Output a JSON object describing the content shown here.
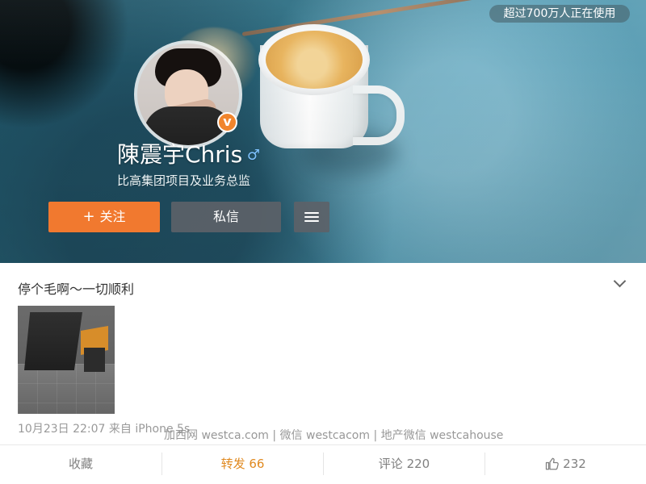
{
  "header": {
    "usage_badge": "超过700万人正在使用"
  },
  "profile": {
    "name": "陳震宇Chris",
    "gender_icon": "♂",
    "title": "比高集团项目及业务总监",
    "verified_icon": "v",
    "actions": {
      "follow_icon": "+",
      "follow_label": "关注",
      "message_label": "私信"
    }
  },
  "post": {
    "text": "停个毛啊～一切顺利",
    "meta": "10月23日 22:07 来自 iPhone 5s"
  },
  "watermark": {
    "text": "加西网 westca.com | 微信 westcacom | 地产微信 westcahouse"
  },
  "bottom_bar": {
    "save_label": "收藏",
    "repost_label": "转发 66",
    "comment_label": "评论 220",
    "like_count": "232"
  },
  "colors": {
    "follow_button": "#f1792f",
    "repost_text": "#e0891f"
  },
  "icons": {
    "menu": "menu-icon",
    "collapse": "chevron-down-icon",
    "like": "thumbs-up-icon"
  }
}
